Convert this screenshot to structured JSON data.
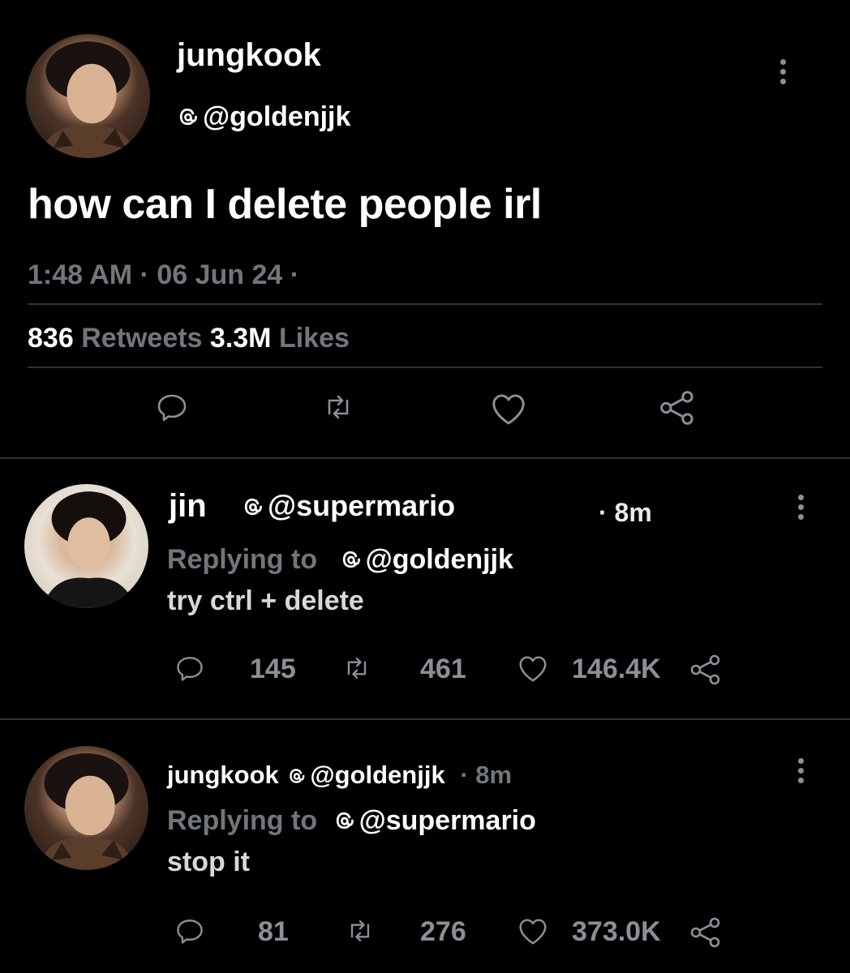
{
  "main_tweet": {
    "display_name": "jungkook",
    "handle": "@goldenjjk",
    "text": "how can I delete people irl",
    "time": "1:48 AM · 06 Jun 24 ·",
    "retweets_count": "836",
    "retweets_label": "Retweets",
    "likes_count": "3.3M",
    "likes_label": "Likes"
  },
  "replies": [
    {
      "display_name": "jin",
      "handle": "@supermario",
      "time": "· 8m",
      "replying_to_label": "Replying to",
      "replying_to_handle": "@goldenjjk",
      "text": "try ctrl + delete",
      "reply_count": "145",
      "retweet_count": "461",
      "like_count": "146.4K"
    },
    {
      "display_name": "jungkook",
      "handle": "@goldenjjk",
      "time": "· 8m",
      "replying_to_label": "Replying to",
      "replying_to_handle": "@supermario",
      "text": "stop it",
      "reply_count": "81",
      "retweet_count": "276",
      "like_count": "373.0K"
    }
  ],
  "icons": {
    "reply": "speech-bubble-icon",
    "retweet": "retweet-arrows-icon",
    "like": "heart-icon",
    "share": "share-nodes-icon",
    "more": "vertical-dots-icon",
    "threads": "threads-at-icon"
  },
  "colors": {
    "background": "#000000",
    "muted": "#71767b",
    "divider": "#2f3336"
  }
}
